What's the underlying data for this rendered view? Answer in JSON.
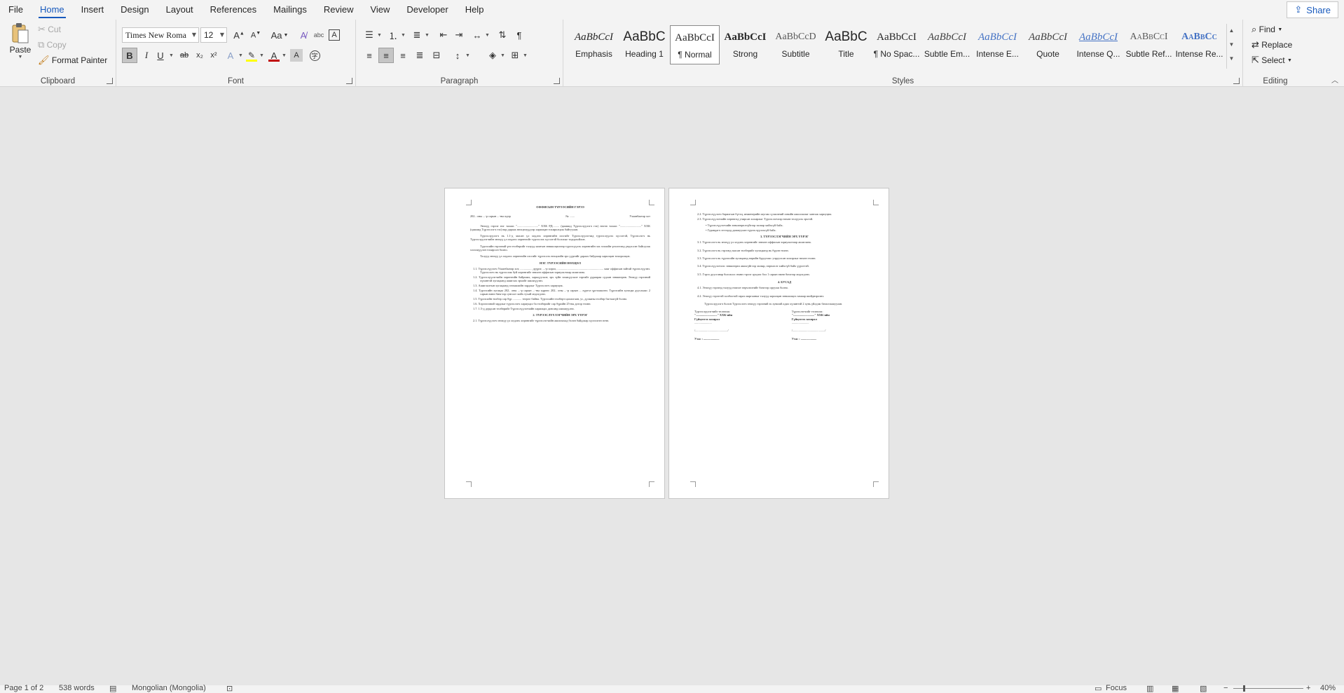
{
  "menu": {
    "items": [
      "File",
      "Home",
      "Insert",
      "Design",
      "Layout",
      "References",
      "Mailings",
      "Review",
      "View",
      "Developer",
      "Help"
    ],
    "active": "Home",
    "share_label": "Share"
  },
  "clipboard": {
    "paste": "Paste",
    "cut": "Cut",
    "copy": "Copy",
    "format_painter": "Format Painter",
    "label": "Clipboard"
  },
  "font": {
    "name": "Times New Roma",
    "size": "12",
    "label": "Font",
    "change_case": "Aa",
    "bold": "B",
    "italic": "I",
    "underline": "U",
    "strike": "ab",
    "subscript": "x₂",
    "superscript": "x²",
    "font_color": "A",
    "highlight_color": "#ffff00",
    "text_color": "#c00000"
  },
  "paragraph": {
    "label": "Paragraph"
  },
  "styles": {
    "label": "Styles",
    "items": [
      {
        "sample": "AaBbCcI",
        "name": "Emphasis"
      },
      {
        "sample": "AaBbC",
        "name": "Heading 1"
      },
      {
        "sample": "AaBbCcI",
        "name": "¶ Normal"
      },
      {
        "sample": "AaBbCcI",
        "name": "Strong"
      },
      {
        "sample": "AaBbCcD",
        "name": "Subtitle"
      },
      {
        "sample": "AaBbC",
        "name": "Title"
      },
      {
        "sample": "AaBbCcI",
        "name": "¶ No Spac..."
      },
      {
        "sample": "AaBbCcI",
        "name": "Subtle Em..."
      },
      {
        "sample": "AaBbCcI",
        "name": "Intense E..."
      },
      {
        "sample": "AaBbCcI",
        "name": "Quote"
      },
      {
        "sample": "AaBbCcI",
        "name": "Intense Q..."
      },
      {
        "sample": "AaBbCcI",
        "name": "Subtle Ref..."
      },
      {
        "sample": "AaBbCc",
        "name": "Intense Re..."
      }
    ],
    "selected": "¶ Normal"
  },
  "editing": {
    "label": "Editing",
    "find": "Find",
    "replace": "Replace",
    "select": "Select"
  },
  "page1": {
    "title": "ОФФИСЫН ТҮРЭЭСИЙН ГЭРЭЭ",
    "date_line": "202.. оны ...-р сарын ...-ны өдөр",
    "number": "№: ......",
    "city": "Улаанбаатар хот",
    "p1": "Энэхүү гэрээг нэг талаас \"............................\" ХХК РД:........ (цаашид Түрээслүүлэгч гэх) нөгөө талаас \"............................\" ХХК (цаашид Түрээслэгч гэх) нар дараах нөхцөлүүдээр харилцан тохиролцож байгуулав.",
    "p2": "Түрээслүүлэгч нь 1.1-д заасан үл хөдлөх хөрөнгийн хэсгийг Түрээслүүлэгчид түрээслүүлэх хүсэлтэй, Түрээслэгч нь Түрээслүүлэгчийн энэхүү үл хөдлөх хөрөнгийг түрээслэх хүсэлтэй болохыг тодорхойлов.",
    "p3": "Түрээсийн гэрээний үнэ төлбөрийг талууд хамтын зөвшилцөлөөр түрээсүүлэх хөрөнгийн зах зээлийн үнэлгээнд үндэслэн байгуулж хэлэлцүүлэн тохирсон болно.",
    "p4": "Талууд энэхүү үл хөдлөх хөрөнгийн хэсгийг түрээслэх нөхцлийн эрх үүргийг дараах байдлаар харилцан тохиролцов.",
    "sec1": "НЭГ. ТҮРЭЭСИЙН НӨХЦӨЛ",
    "items": [
      "1.1. Түрээслүүлэгч Улаанбаатар хот, ................ дүүрэг, ...-р хороо, ............................................................. хаяг оффисын зайтай түрээслүүлнэ. Түрээслэгч нь түрээслэж буй хөрөнгийг зөвхөн оффисын зориулалтаар ашиглана.",
      "1.2. Түрээслүүлэгчийн хөрөнгийн байршил, харьцуулалт, эрх зүйн зохицуулалт зэргийг дураараа судлан зөвшөөрөв. Энэхүү гэрээний хүчинтэй хугацаанд ашиглах эрхийг шилжүүлнэ.",
      "1.3. Ашиглалтын хугацаанд эзэмшлийн зардлыг Түрээслэгч хариуцна.",
      "1.4. Түрээсийн хугацаа 202.. оны ...-р сарын ...-ны өдрөөс 202.. оны ...-р сарын ... хүртэл үргэлжилнэ. Түрээсийн хугацаа дуусахаас 2 сарын өмнө бичгээр сунгалт хийх тухай мэдэгдэнэ.",
      "1.5. Түрээсийн төлбөр сар бүр ............ төгрөг байна. Түрээсийн төлбөрт цахилгаан, ус, дулааны төлбөр багтаагүй болно.",
      "1.6. Хэрэглээний зардлыг түрээслэгч хариуцах ба төлбөрийг сар бүрийн 25-ны дотор төлнө.",
      "1.7. 1.5-д дурдсан төлбөрийг Түрээслүүлэгчийн харилцах дансанд шилжүүлнэ."
    ],
    "sec2": "2. ТҮРЭЭСЛҮҮЛЭГЧИЙН ЭРХ ҮҮРЭГ",
    "p5": "2.1. Түрээслүүлэгч энэхүү үл хөдлөх хөрөнгийг түрээслэгчийн ашиглахад бэлэн байдлаар хүлээлгэн өгнө."
  },
  "page2": {
    "items_top": [
      "2.2. Түрээслүүлэгч барилгын бүтэц, инженерийн шугам сүлжээний хэвийн ажиллагааг хангаж хариуцна.",
      "2.3. Түрээслүүлэгчийн хөрөнгөд учирсан хохирлыг Түрээслэгчээр нөхөн төлүүлэх эрхтэй.",
      "Түрээслүүлэгчийн зөвшөөрөлгүйгээр засвар хийхгүй байх.",
      "Гуравдагч этгээдэд дамжуулан түрээслүүлэхгүй байх."
    ],
    "sec3": "3. ТҮРЭЭСЛЭГЧИЙН ЭРХ ҮҮРЭГ",
    "items_mid": [
      "3.1. Түрээслэгч нь энэхүү үл хөдлөх хөрөнгийг зөвхөн оффисын зориулалтаар ашиглана.",
      "3.2. Түрээслэгч нь гэрээнд заасан төлбөрийг хугацаанд нь бүрэн төлнө.",
      "3.3. Түрээслэгч нь түрээсийн хугацаанд өөрийн буруугаас учруулсан хохирлыг нөхөн төлнө.",
      "3.4. Түрээслүүлэгчээс зөвшөөрөл авахгүйгээр засвар, өөрчлөлт хийхгүй байх үүрэгтэй.",
      "3.5. Гэрээ дуусгавар болохоос өмнө гэрээг цуцлах бол 1 сарын өмнө бичгээр мэдэгдэнэ."
    ],
    "sec4": "4. БУСАД",
    "items_end": [
      "4.1. Энэхүү гэрээнд талууд нэмэлт өөрчлөлтийг бичгээр оруулж болно.",
      "4.2. Энэхүү гэрээтэй холбоотой гарах маргааныг талууд харилцан зөвшилцөх замаар шийдвэрлэнэ."
    ],
    "p_end": "Түрээслүүлэгч болон Түрээслэгч энэхүү гэрээний эх хувьтай адил хүчинтэй 2 хувь үйлдэж баталгаажуулав.",
    "sig_left": [
      "Түрээслүүлэгчийг төлөөлж:",
      "\"............................\" ХХК-ийн",
      "Гүйцэтгэх захирал",
      ".......................",
      "/.........................................../",
      "Утас : ....................."
    ],
    "sig_right": [
      "Түрээслэгчийг төлөөлж:",
      "\"............................\" ХХК-ийн",
      "Гүйцэтгэх захирал",
      ".......................",
      "/.........................................../",
      "Утас : ....................."
    ]
  },
  "status": {
    "page": "Page 1 of 2",
    "words": "538 words",
    "language": "Mongolian (Mongolia)",
    "focus": "Focus",
    "zoom": "40%"
  }
}
